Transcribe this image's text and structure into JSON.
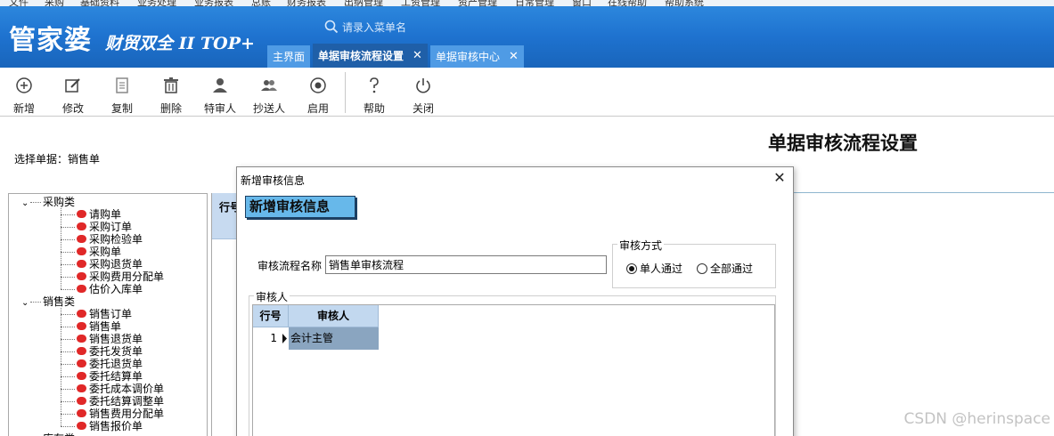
{
  "menu": [
    "文件",
    "采购",
    "基础资料",
    "业务处理",
    "业务报表",
    "总账",
    "财务报表",
    "出纳管理",
    "工资管理",
    "资产管理",
    "日常管理",
    "窗口",
    "在线帮助",
    "帮助系统"
  ],
  "app": {
    "logo": "管家婆",
    "edition": "财贸双全 II TOP+",
    "search_placeholder": "请录入菜单名"
  },
  "tabs": [
    {
      "label": "主界面",
      "active": false,
      "closable": false
    },
    {
      "label": "单据审核流程设置",
      "active": true,
      "closable": true
    },
    {
      "label": "单据审核中心",
      "active": false,
      "closable": true
    }
  ],
  "toolbar": [
    {
      "label": "新增",
      "icon": "add-circle-icon"
    },
    {
      "label": "修改",
      "icon": "edit-icon"
    },
    {
      "label": "复制",
      "icon": "copy-icon"
    },
    {
      "label": "删除",
      "icon": "trash-icon"
    },
    {
      "label": "特审人",
      "icon": "user-icon"
    },
    {
      "label": "抄送人",
      "icon": "users-icon"
    },
    {
      "label": "启用",
      "icon": "radio-on-icon"
    },
    {
      "label": "帮助",
      "icon": "question-icon"
    },
    {
      "label": "关闭",
      "icon": "power-icon"
    }
  ],
  "page": {
    "title": "单据审核流程设置",
    "select_doc_label": "选择单据：",
    "select_doc_value": "销售单"
  },
  "tree": {
    "categories": [
      {
        "label": "采购类",
        "items": [
          "请购单",
          "采购订单",
          "采购检验单",
          "采购单",
          "采购退货单",
          "采购费用分配单",
          "估价入库单"
        ]
      },
      {
        "label": "销售类",
        "items": [
          "销售订单",
          "销售单",
          "销售退货单",
          "委托发货单",
          "委托退货单",
          "委托结算单",
          "委托成本调价单",
          "委托结算调整单",
          "销售费用分配单",
          "销售报价单"
        ]
      },
      {
        "label": "库存类",
        "items": []
      }
    ]
  },
  "main_grid": {
    "col_row_no": "行号"
  },
  "dialog": {
    "title": "新增审核信息",
    "banner": "新增审核信息",
    "name_label": "审核流程名称",
    "name_value": "销售单审核流程",
    "mode_group": "审核方式",
    "mode_single": "单人通过",
    "mode_all": "全部通过",
    "mode_selected": "单人通过",
    "reviewers_group": "审核人",
    "grid_headers": [
      "行号",
      "审核人"
    ],
    "rows": [
      {
        "no": "1",
        "reviewer": "会计主管"
      }
    ]
  },
  "watermark": "CSDN @herinspace",
  "colors": {
    "banner": "#1e72cf",
    "active_tab": "#1f5fa8",
    "dialog_banner": "#67b8ea",
    "selected_row": "#8aa5c0",
    "leaf_dot": "#e02828"
  }
}
